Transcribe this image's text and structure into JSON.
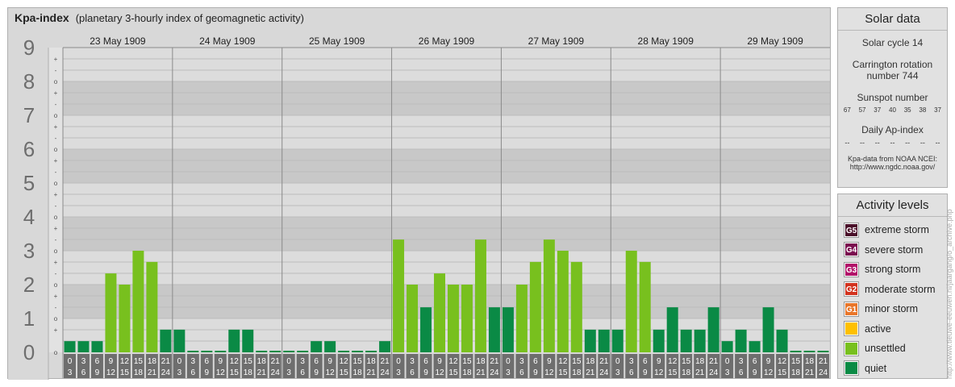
{
  "header": {
    "title": "Kpa-index",
    "subtitle": "(planetary 3-hourly index of geomagnetic activity)"
  },
  "chart_data": {
    "type": "bar",
    "ylim": [
      0,
      9
    ],
    "y_ticks": [
      "0",
      "1",
      "2",
      "3",
      "4",
      "5",
      "6",
      "7",
      "8",
      "9"
    ],
    "minor_marks": [
      "+",
      "o",
      "-"
    ],
    "days": [
      "23 May 1909",
      "24 May 1909",
      "25 May 1909",
      "26 May 1909",
      "27 May 1909",
      "28 May 1909",
      "29 May 1909"
    ],
    "interval_labels": [
      [
        "0",
        "3"
      ],
      [
        "3",
        "6"
      ],
      [
        "6",
        "9"
      ],
      [
        "9",
        "12"
      ],
      [
        "12",
        "15"
      ],
      [
        "15",
        "18"
      ],
      [
        "18",
        "21"
      ],
      [
        "21",
        "24"
      ]
    ],
    "values": [
      [
        0.33,
        0.33,
        0.33,
        2.33,
        2.0,
        3.0,
        2.67,
        0.67
      ],
      [
        0.67,
        0.0,
        0.0,
        0.0,
        0.67,
        0.67,
        0.0,
        0.0
      ],
      [
        0.0,
        0.0,
        0.33,
        0.33,
        0.0,
        0.0,
        0.0,
        0.33
      ],
      [
        3.33,
        2.0,
        1.33,
        2.33,
        2.0,
        2.0,
        3.33,
        1.33
      ],
      [
        1.33,
        2.0,
        2.67,
        3.33,
        3.0,
        2.67,
        0.67,
        0.67
      ],
      [
        0.67,
        3.0,
        2.67,
        0.67,
        1.33,
        0.67,
        0.67,
        1.33
      ],
      [
        0.33,
        0.67,
        0.33,
        1.33,
        0.67,
        0.0,
        0.0,
        0.0
      ]
    ],
    "level_colors": {
      "quiet": "#0a8a45",
      "unsettled": "#78c01e",
      "active": "#fec000",
      "G1": "#e9762a",
      "G2": "#d2321e",
      "G3": "#b21269",
      "G4": "#7b0f4f",
      "G5": "#4a0f29"
    }
  },
  "solar": {
    "title": "Solar data",
    "cycle": "Solar cycle 14",
    "carrington_1": "Carrington rotation",
    "carrington_2": "number 744",
    "sunspot_label": "Sunspot number",
    "sunspots": [
      "67",
      "57",
      "37",
      "40",
      "35",
      "38",
      "37"
    ],
    "ap_label": "Daily Ap-index",
    "ap_values": [
      "--",
      "--",
      "--",
      "--",
      "--",
      "--",
      "--"
    ],
    "source_1": "Kpa-data from NOAA NCEI:",
    "source_2": "http://www.ngdc.noaa.gov/"
  },
  "levels": {
    "title": "Activity levels",
    "items": [
      {
        "badge": "G5",
        "label": "extreme storm",
        "color": "#4a0f29"
      },
      {
        "badge": "G4",
        "label": "severe storm",
        "color": "#7b0f4f"
      },
      {
        "badge": "G3",
        "label": "strong storm",
        "color": "#b21269"
      },
      {
        "badge": "G2",
        "label": "moderate storm",
        "color": "#d2321e"
      },
      {
        "badge": "G1",
        "label": "minor storm",
        "color": "#e9762a"
      },
      {
        "badge": "",
        "label": "active",
        "color": "#fec000"
      },
      {
        "badge": "",
        "label": "unsettled",
        "color": "#78c01e"
      },
      {
        "badge": "",
        "label": "quiet",
        "color": "#0a8a45"
      }
    ]
  },
  "credit": "http://www.tieuwe-eeuwen.nl/jaargang/o_archive.php"
}
